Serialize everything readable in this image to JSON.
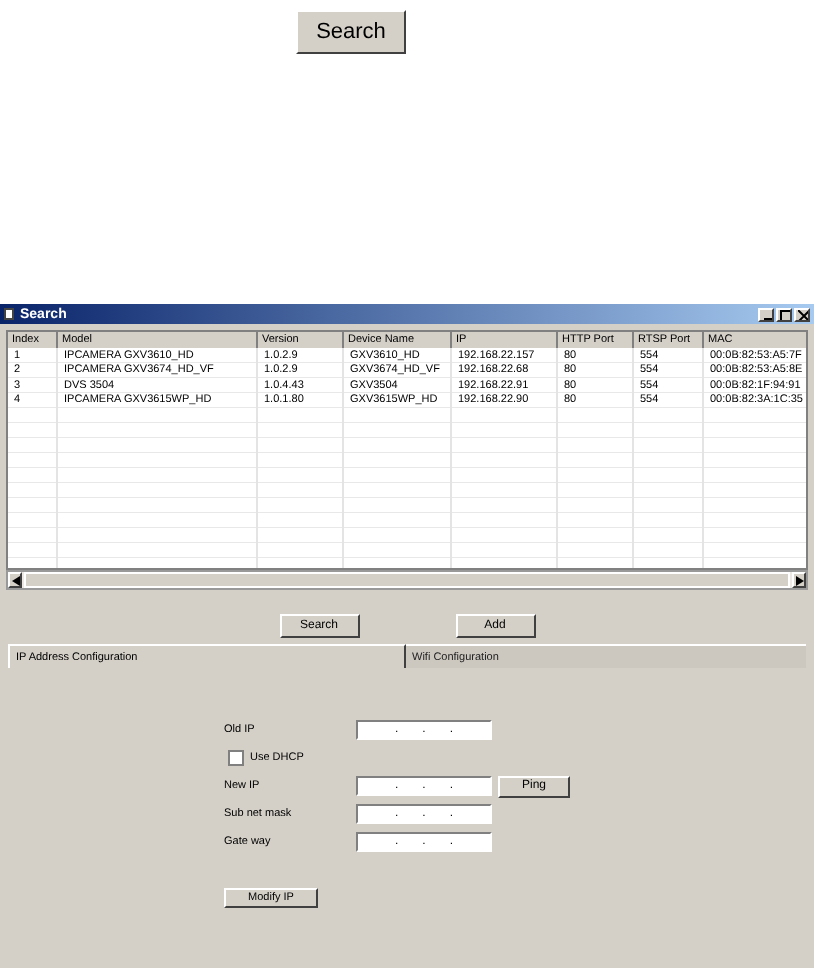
{
  "top_button": "Search",
  "window": {
    "title": "Search"
  },
  "table": {
    "columns": [
      "Index",
      "Model",
      "Version",
      "Device Name",
      "IP",
      "HTTP Port",
      "RTSP Port",
      "MAC"
    ],
    "rows": [
      [
        "1",
        "IPCAMERA GXV3610_HD",
        "1.0.2.9",
        "GXV3610_HD",
        "192.168.22.157",
        "80",
        "554",
        "00:0B:82:53:A5:7F"
      ],
      [
        "2",
        "IPCAMERA GXV3674_HD_VF",
        "1.0.2.9",
        "GXV3674_HD_VF",
        "192.168.22.68",
        "80",
        "554",
        "00:0B:82:53:A5:8E"
      ],
      [
        "3",
        "DVS 3504",
        "1.0.4.43",
        "GXV3504",
        "192.168.22.91",
        "80",
        "554",
        "00:0B:82:1F:94:91"
      ],
      [
        "4",
        "IPCAMERA GXV3615WP_HD",
        "1.0.1.80",
        "GXV3615WP_HD",
        "192.168.22.90",
        "80",
        "554",
        "00:0B:82:3A:1C:35"
      ]
    ]
  },
  "buttons": [
    "Search",
    "Add"
  ],
  "tabs": [
    {
      "label": "IP Address Configuration",
      "selected": true
    },
    {
      "label": "Wifi Configuration",
      "selected": false
    }
  ],
  "form": [
    {
      "kind": "ip",
      "label": "Old IP",
      "separator": "."
    },
    {
      "kind": "checkbox",
      "label": "Use DHCP",
      "checked": false
    },
    {
      "kind": "ip",
      "label": "New IP",
      "separator": ".",
      "button": "Ping"
    },
    {
      "kind": "ip",
      "label": "Sub net mask",
      "separator": "."
    },
    {
      "kind": "ip",
      "label": "Gate way",
      "separator": "."
    }
  ],
  "modify_button": "Modify IP"
}
